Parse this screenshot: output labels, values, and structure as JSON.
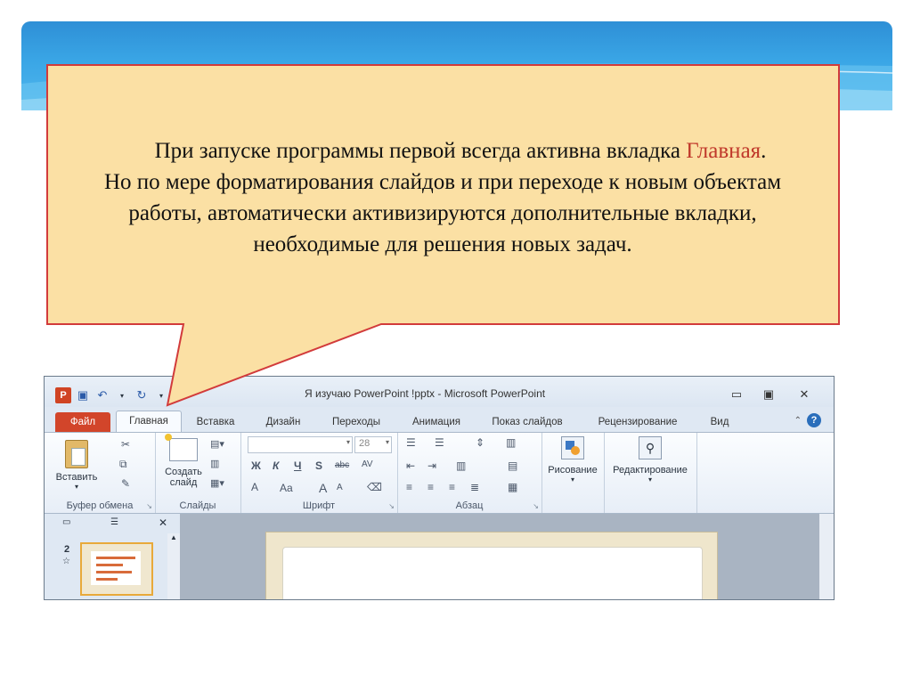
{
  "callout": {
    "line1_before": "При запуске программы первой всегда активна вкладка ",
    "line1_highlight": "Главная",
    "line1_after": ".",
    "line2": "Но по мере форматирования слайдов и при переходе к новым объектам",
    "line3": "работы, автоматически активизируются дополнительные вкладки,",
    "line4": "необходимые для решения новых задач."
  },
  "window": {
    "title": "Я изучаю PowerPoint !pptx - Microsoft PowerPoint",
    "app_icon": "P",
    "controls": {
      "minimize": "▭",
      "restore": "▣",
      "close": "✕"
    }
  },
  "tabs": [
    "Файл",
    "Главная",
    "Вставка",
    "Дизайн",
    "Переходы",
    "Анимация",
    "Показ слайдов",
    "Рецензирование",
    "Вид"
  ],
  "ribbon": {
    "clipboard": {
      "paste": "Вставить",
      "label": "Буфер обмена"
    },
    "slides": {
      "create_line1": "Создать",
      "create_line2": "слайд",
      "label": "Слайды"
    },
    "font": {
      "size": "28",
      "bold": "Ж",
      "italic": "К",
      "underline": "Ч",
      "strike": "S",
      "strike2": "abc",
      "spacing": "AV",
      "font_color": "A",
      "case": "Aa",
      "grow": "A",
      "shrink": "A",
      "label": "Шрифт"
    },
    "paragraph": {
      "label": "Абзац"
    },
    "drawing": {
      "label": "Рисование"
    },
    "editing": {
      "label": "Редактирование"
    }
  },
  "slides_panel": {
    "slide_number": "2",
    "star": "☆"
  },
  "colors": {
    "callout_fill": "#fbe0a4",
    "callout_border": "#d23b3b",
    "highlight": "#c0392b",
    "file_tab": "#d2452a"
  }
}
